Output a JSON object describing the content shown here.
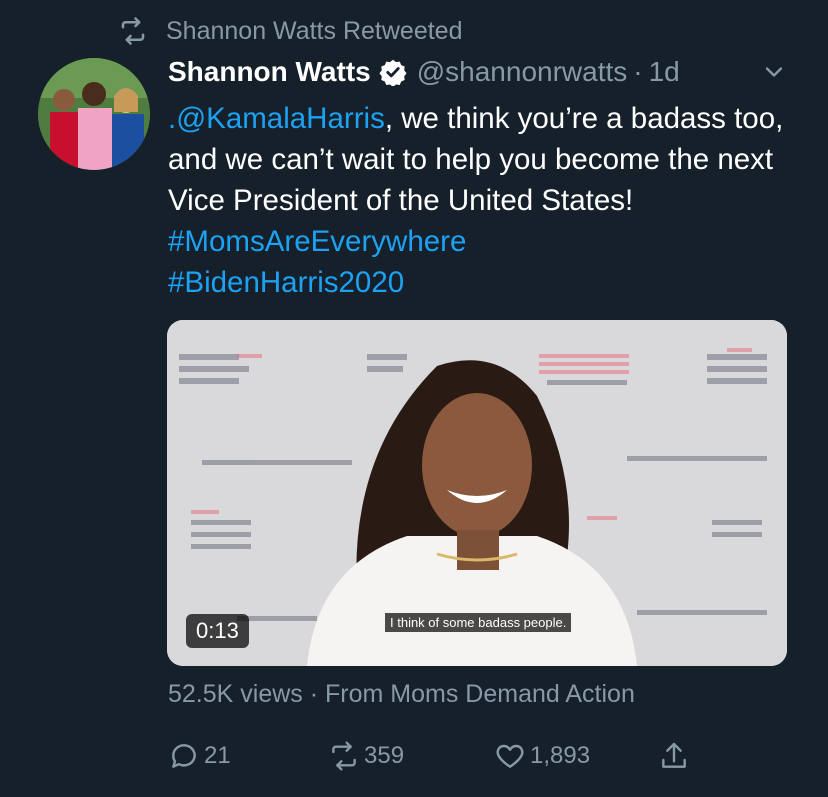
{
  "retweet_banner": {
    "text": "Shannon Watts Retweeted",
    "icon": "retweet-icon"
  },
  "author": {
    "name": "Shannon Watts",
    "handle": "@shannonrwatts",
    "separator": "·",
    "time": "1d",
    "verified": true
  },
  "tweet": {
    "mention": ".@KamalaHarris",
    "body": ", we think you’re a badass too, and we can’t wait to help you become the next Vice President of the United States! ",
    "hashtag1": "#MomsAreEverywhere",
    "hashtag2": "#BidenHarris2020"
  },
  "media": {
    "duration": "0:13",
    "caption": "I think of some badass people."
  },
  "meta": {
    "views": "52.5K views",
    "separator": "·",
    "source": "From Moms Demand Action"
  },
  "actions": {
    "replies": "21",
    "retweets": "359",
    "likes": "1,893"
  },
  "colors": {
    "background": "#15202b",
    "accent": "#1da1f2",
    "muted": "#8899a6"
  }
}
